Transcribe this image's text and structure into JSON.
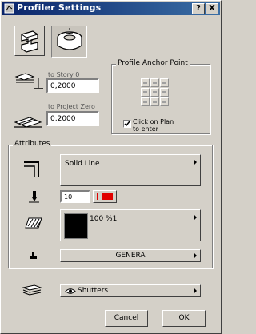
{
  "window": {
    "title": "Profiler Settings",
    "help_label": "?",
    "close_label": "X"
  },
  "top": {
    "to_story_label": "to Story 0",
    "to_story_value": "0,2000",
    "to_project_zero_label": "to Project Zero",
    "to_project_zero_value": "0,2000"
  },
  "anchor": {
    "title": "Profile Anchor Point",
    "click_on_plan_label_1": "Click on Plan",
    "click_on_plan_label_2": "to enter",
    "click_on_plan_checked": true
  },
  "attributes": {
    "title": "Attributes",
    "line_type": "Solid Line",
    "pen_number": "10",
    "pen_color": "#e00000",
    "fill_pattern": "100 %1",
    "fill_color": "#000000",
    "material": "GENERA"
  },
  "layer": {
    "value": "Shutters"
  },
  "buttons": {
    "cancel": "Cancel",
    "ok": "OK"
  }
}
